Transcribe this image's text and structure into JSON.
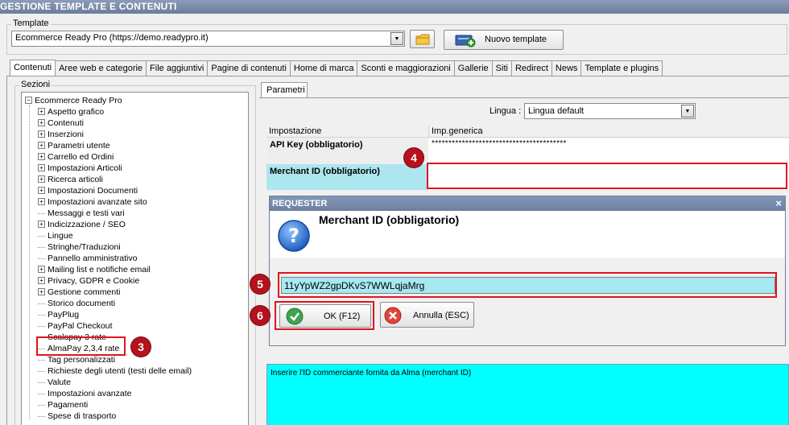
{
  "window": {
    "title": "GESTIONE TEMPLATE E CONTENUTI"
  },
  "template": {
    "group_label": "Template",
    "selected": "Ecommerce Ready Pro (https://demo.readypro.it)",
    "new_button_label": "Nuovo template"
  },
  "tabs": [
    {
      "label": "Contenuti",
      "active": true
    },
    {
      "label": "Aree web e categorie"
    },
    {
      "label": "File aggiuntivi"
    },
    {
      "label": "Pagine di contenuti"
    },
    {
      "label": "Home di marca"
    },
    {
      "label": "Sconti e maggiorazioni"
    },
    {
      "label": "Gallerie"
    },
    {
      "label": "Siti"
    },
    {
      "label": "Redirect"
    },
    {
      "label": "News"
    },
    {
      "label": "Template e plugins"
    }
  ],
  "sections": {
    "group_label": "Sezioni",
    "root": "Ecommerce Ready Pro",
    "items": [
      {
        "label": "Aspetto grafico",
        "expandable": true
      },
      {
        "label": "Contenuti",
        "expandable": true
      },
      {
        "label": "Inserzioni",
        "expandable": true
      },
      {
        "label": "Parametri utente",
        "expandable": true
      },
      {
        "label": "Carrello ed Ordini",
        "expandable": true
      },
      {
        "label": "Impostazioni Articoli",
        "expandable": true
      },
      {
        "label": "Ricerca articoli",
        "expandable": true
      },
      {
        "label": "Impostazioni Documenti",
        "expandable": true
      },
      {
        "label": "Impostazioni avanzate sito",
        "expandable": true
      },
      {
        "label": "Messaggi e testi vari",
        "expandable": false
      },
      {
        "label": "Indicizzazione / SEO",
        "expandable": true
      },
      {
        "label": "Lingue",
        "expandable": false
      },
      {
        "label": "Stringhe/Traduzioni",
        "expandable": false
      },
      {
        "label": "Pannello amministrativo",
        "expandable": false
      },
      {
        "label": "Mailing list e notifiche email",
        "expandable": true
      },
      {
        "label": "Privacy, GDPR e Cookie",
        "expandable": true
      },
      {
        "label": "Gestione commenti",
        "expandable": true
      },
      {
        "label": "Storico documenti",
        "expandable": false
      },
      {
        "label": "PayPlug",
        "expandable": false
      },
      {
        "label": "PayPal Checkout",
        "expandable": false
      },
      {
        "label": "Scalapay 3 rate",
        "expandable": false
      },
      {
        "label": "AlmaPay 2,3,4 rate",
        "expandable": false,
        "selected": true
      },
      {
        "label": "Tag personalizzati",
        "expandable": false
      },
      {
        "label": "Richieste degli utenti (testi delle email)",
        "expandable": false
      },
      {
        "label": "Valute",
        "expandable": false
      },
      {
        "label": "Impostazioni avanzate",
        "expandable": false
      },
      {
        "label": "Pagamenti",
        "expandable": false
      },
      {
        "label": "Spese di trasporto",
        "expandable": false
      }
    ]
  },
  "params": {
    "tab_label": "Parametri",
    "language_label": "Lingua :",
    "language_selected": "Lingua default",
    "col_setting": "Impostazione",
    "col_value": "Imp.generica",
    "rows": [
      {
        "label": "API Key (obbligatorio)",
        "value": "****************************************"
      },
      {
        "label": "Merchant ID (obbligatorio)",
        "value": ""
      }
    ],
    "description": "Inserire l'ID commerciante fornita da Alma (merchant ID)"
  },
  "dialog": {
    "title": "REQUESTER",
    "close_glyph": "×",
    "heading": "Merchant ID (obbligatorio)",
    "input_value": "11yYpWZ2gpDKvS7WWLqjaMrg",
    "ok_label": "OK (F12)",
    "cancel_label": "Annulla (ESC)"
  },
  "callouts": [
    "3",
    "4",
    "5",
    "6"
  ],
  "colors": {
    "titlebar": "#7a8aab",
    "highlight": "#00ffff",
    "selected_row": "#aee6ef",
    "callout_red": "#e0141e"
  }
}
